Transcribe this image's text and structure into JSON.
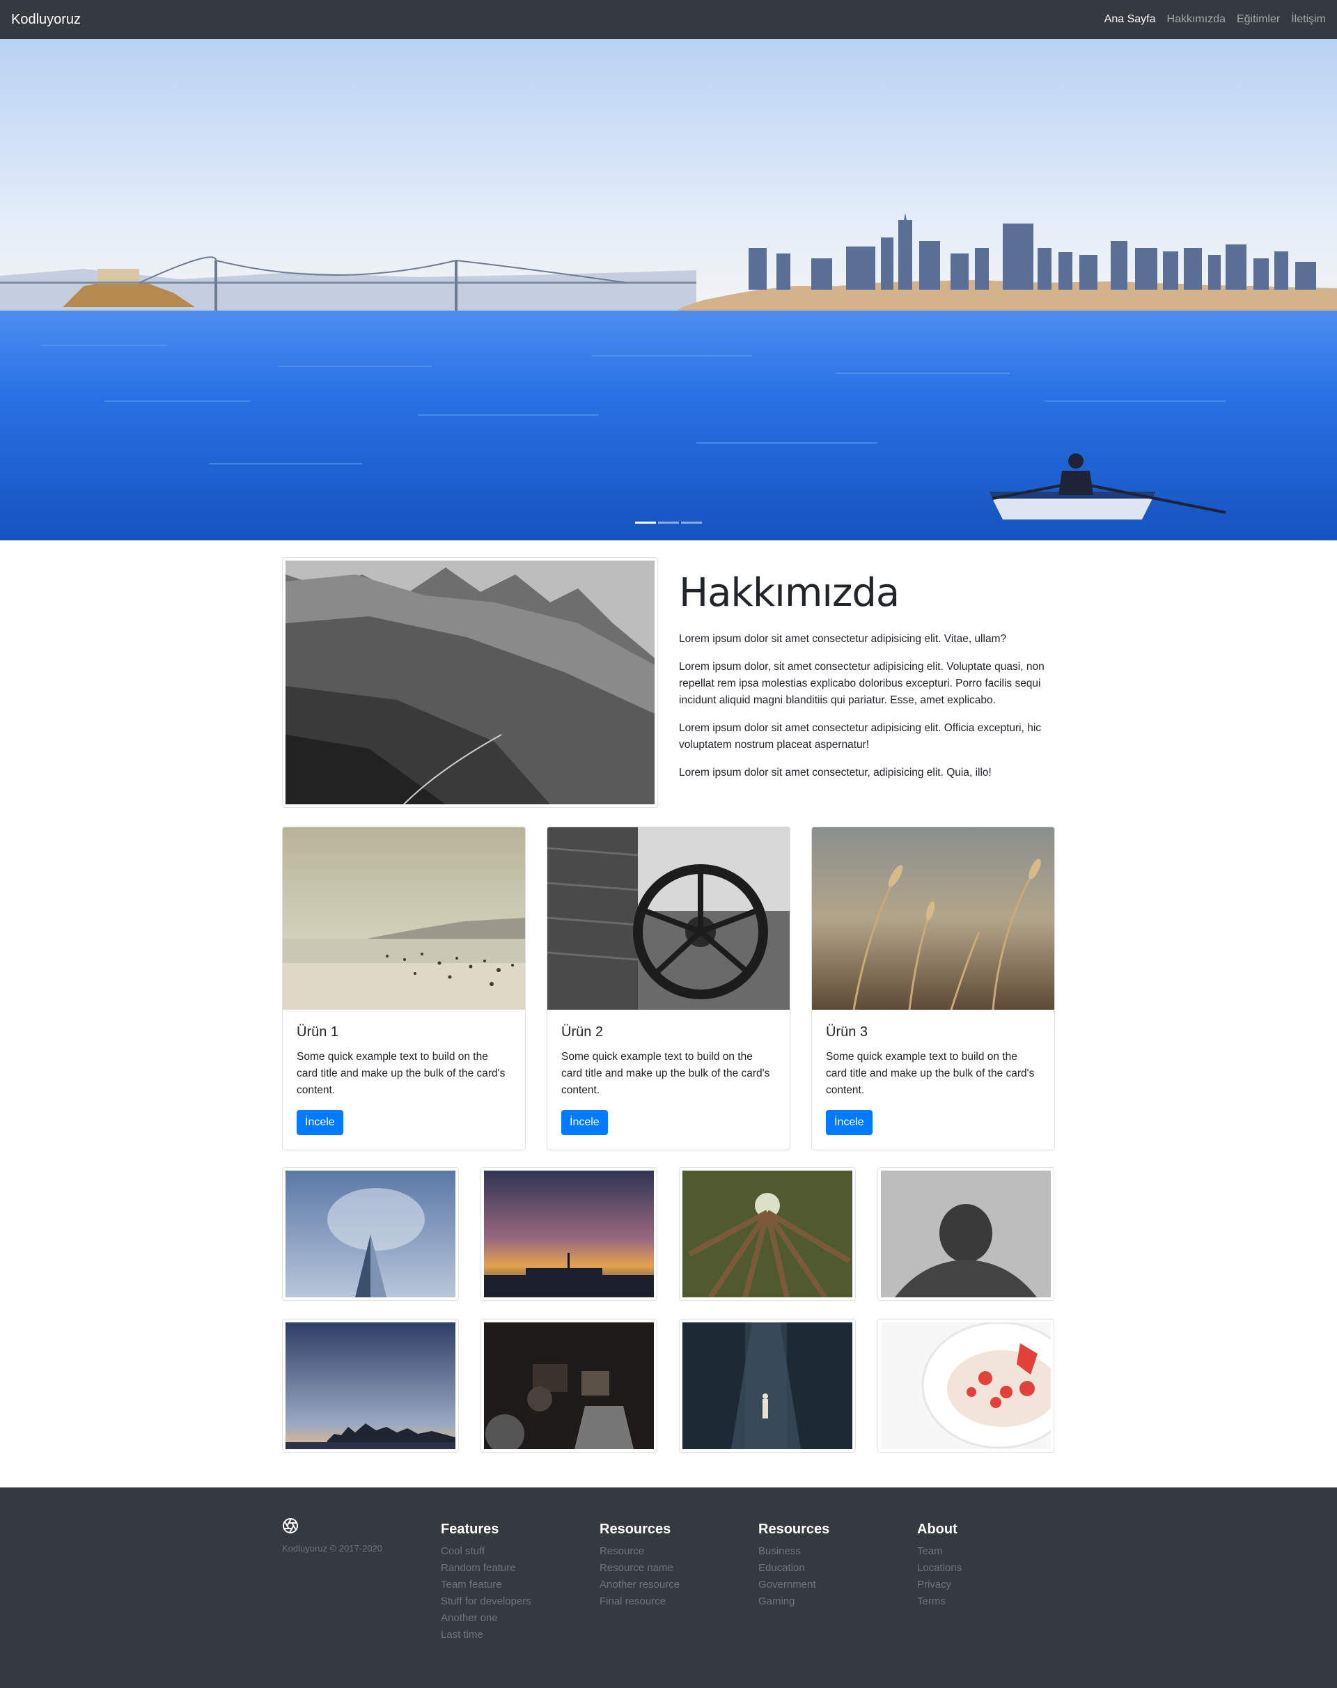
{
  "navbar": {
    "brand": "Kodluyoruz",
    "links": [
      "Ana Sayfa",
      "Hakkımızda",
      "Eğitimler",
      "İletişim"
    ]
  },
  "about": {
    "title": "Hakkımızda",
    "paragraphs": [
      "Lorem ipsum dolor sit amet consectetur adipisicing elit. Vitae, ullam?",
      "Lorem ipsum dolor, sit amet consectetur adipisicing elit. Voluptate quasi, non repellat rem ipsa molestias explicabo doloribus excepturi. Porro facilis sequi incidunt aliquid magni blanditiis qui pariatur. Esse, amet explicabo.",
      "Lorem ipsum dolor sit amet consectetur adipisicing elit. Officia excepturi, hic voluptatem nostrum placeat aspernatur!",
      "Lorem ipsum dolor sit amet consectetur, adipisicing elit. Quia, illo!"
    ]
  },
  "cards": [
    {
      "title": "Ürün 1",
      "text": "Some quick example text to build on the card title and make up the bulk of the card's content.",
      "button": "İncele"
    },
    {
      "title": "Ürün 2",
      "text": "Some quick example text to build on the card title and make up the bulk of the card's content.",
      "button": "İncele"
    },
    {
      "title": "Ürün 3",
      "text": "Some quick example text to build on the card title and make up the bulk of the card's content.",
      "button": "İncele"
    }
  ],
  "carousel": {
    "slide_count": 3,
    "active_index": 0
  },
  "footer": {
    "copyright": "Kodluyoruz © 2017-2020",
    "columns": [
      {
        "heading": "Features",
        "items": [
          "Cool stuff",
          "Random feature",
          "Team feature",
          "Stuff for developers",
          "Another one",
          "Last time"
        ]
      },
      {
        "heading": "Resources",
        "items": [
          "Resource",
          "Resource name",
          "Another resource",
          "Final resource"
        ]
      },
      {
        "heading": "Resources",
        "items": [
          "Business",
          "Education",
          "Government",
          "Gaming"
        ]
      },
      {
        "heading": "About",
        "items": [
          "Team",
          "Locations",
          "Privacy",
          "Terms"
        ]
      }
    ]
  },
  "colors": {
    "navbar_bg": "#343a40",
    "footer_bg": "#343a40",
    "primary": "#007bff",
    "muted": "#6c757d"
  }
}
